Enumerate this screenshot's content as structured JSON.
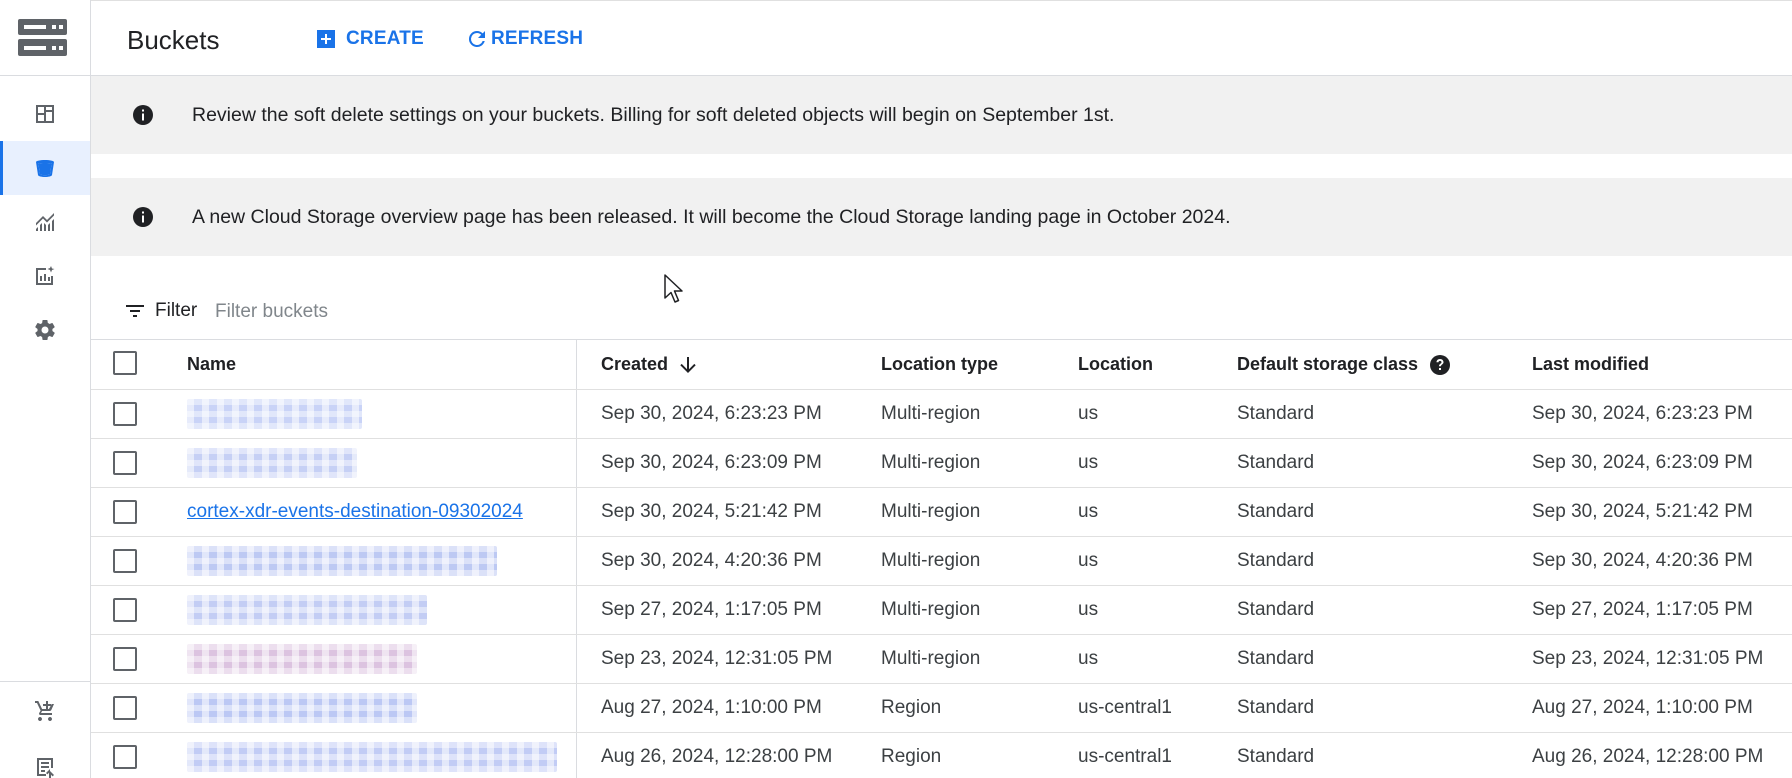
{
  "header": {
    "title": "Buckets",
    "create_label": "CREATE",
    "refresh_label": "REFRESH"
  },
  "colors": {
    "accent": "#1a73e8",
    "banner_bg": "#f1f1f1",
    "active_nav_bg": "#e8f0fe"
  },
  "sidebar": {
    "items": [
      {
        "icon": "dashboard-icon",
        "active": false
      },
      {
        "icon": "bucket-icon",
        "active": true
      },
      {
        "icon": "monitoring-icon",
        "active": false
      },
      {
        "icon": "insights-icon",
        "active": false
      },
      {
        "icon": "gear-icon",
        "active": false
      },
      {
        "icon": "marketplace-cart-icon",
        "active": false
      },
      {
        "icon": "release-notes-icon",
        "active": false
      }
    ]
  },
  "banners": [
    {
      "icon": "info-icon",
      "message": "Review the soft delete settings on your buckets. Billing for soft deleted objects will begin on September 1st."
    },
    {
      "icon": "info-icon",
      "message": "A new Cloud Storage overview page has been released. It will become the Cloud Storage landing page in October 2024."
    }
  ],
  "filter": {
    "label": "Filter",
    "placeholder": "Filter buckets"
  },
  "table": {
    "columns": {
      "name": "Name",
      "created": "Created",
      "location_type": "Location type",
      "location": "Location",
      "default_storage_class": "Default storage class",
      "last_modified": "Last modified"
    },
    "sort": {
      "column": "created",
      "direction": "descending"
    },
    "rows": [
      {
        "name": "",
        "name_redacted": true,
        "redaction_color": "#c9d3f7",
        "created": "Sep 30, 2024, 6:23:23 PM",
        "location_type": "Multi-region",
        "location": "us",
        "storage_class": "Standard",
        "last_modified": "Sep 30, 2024, 6:23:23 PM"
      },
      {
        "name": "",
        "name_redacted": true,
        "redaction_color": "#c6d0f5",
        "created": "Sep 30, 2024, 6:23:09 PM",
        "location_type": "Multi-region",
        "location": "us",
        "storage_class": "Standard",
        "last_modified": "Sep 30, 2024, 6:23:09 PM"
      },
      {
        "name": "cortex-xdr-events-destination-09302024",
        "name_redacted": false,
        "created": "Sep 30, 2024, 5:21:42 PM",
        "location_type": "Multi-region",
        "location": "us",
        "storage_class": "Standard",
        "last_modified": "Sep 30, 2024, 5:21:42 PM"
      },
      {
        "name": "",
        "name_redacted": true,
        "redaction_color": "#bdc9f3",
        "created": "Sep 30, 2024, 4:20:36 PM",
        "location_type": "Multi-region",
        "location": "us",
        "storage_class": "Standard",
        "last_modified": "Sep 30, 2024, 4:20:36 PM"
      },
      {
        "name": "",
        "name_redacted": true,
        "redaction_color": "#c3cdf4",
        "created": "Sep 27, 2024, 1:17:05 PM",
        "location_type": "Multi-region",
        "location": "us",
        "storage_class": "Standard",
        "last_modified": "Sep 27, 2024, 1:17:05 PM"
      },
      {
        "name": "",
        "name_redacted": true,
        "redaction_color": "#dcc3e0",
        "created": "Sep 23, 2024, 12:31:05 PM",
        "location_type": "Multi-region",
        "location": "us",
        "storage_class": "Standard",
        "last_modified": "Sep 23, 2024, 12:31:05 PM"
      },
      {
        "name": "",
        "name_redacted": true,
        "redaction_color": "#bcc8f4",
        "created": "Aug 27, 2024, 1:10:00 PM",
        "location_type": "Region",
        "location": "us-central1",
        "storage_class": "Standard",
        "last_modified": "Aug 27, 2024, 1:10:00 PM"
      },
      {
        "name": "",
        "name_redacted": true,
        "redaction_color": "#c2ccf5",
        "created": "Aug 26, 2024, 12:28:00 PM",
        "location_type": "Region",
        "location": "us-central1",
        "storage_class": "Standard",
        "last_modified": "Aug 26, 2024, 12:28:00 PM"
      }
    ]
  }
}
